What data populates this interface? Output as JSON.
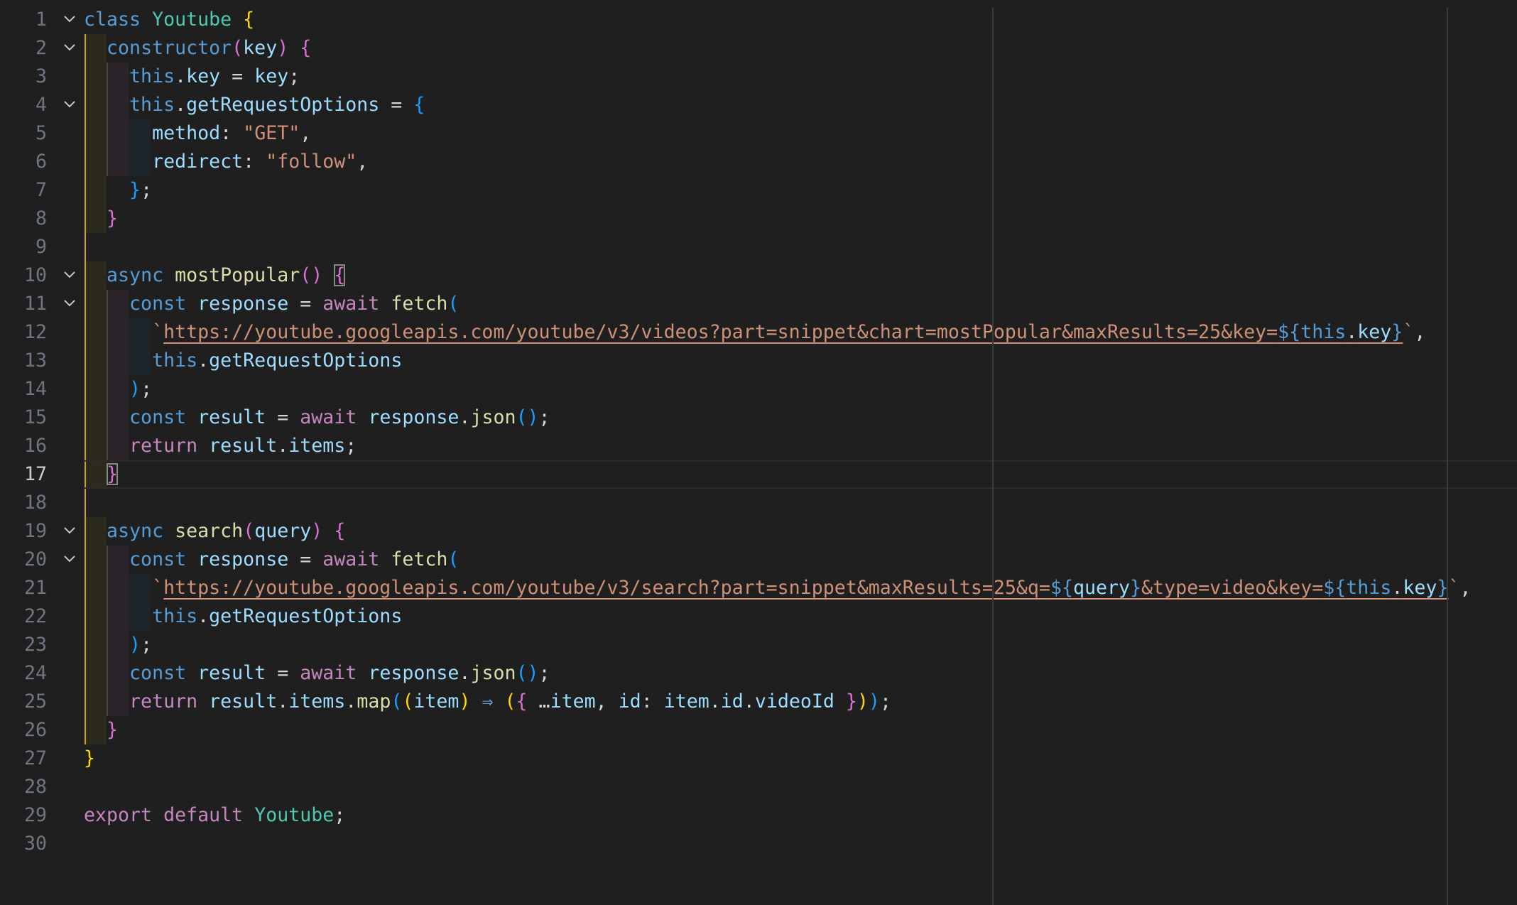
{
  "colors": {
    "background": "#1f1f1f",
    "keyword": "#569cd6",
    "control": "#c586c0",
    "class": "#4ec9b0",
    "function": "#dcdcaa",
    "variable": "#9cdcfe",
    "string": "#ce9178",
    "bracket_level1": "#ffd700",
    "bracket_level2": "#da70d6",
    "bracket_level3": "#179fff"
  },
  "icons": {
    "fold": "chevron-down-icon"
  },
  "editor": {
    "active_line": 17,
    "lines": [
      {
        "number": "1",
        "fold": true,
        "tokens": [
          [
            "class",
            "kw"
          ],
          [
            " ",
            "p"
          ],
          [
            "Youtube",
            "cls"
          ],
          [
            " ",
            "p"
          ],
          [
            "{",
            "b1"
          ]
        ]
      },
      {
        "number": "2",
        "fold": true,
        "tokens": [
          [
            "  ",
            "p"
          ],
          [
            "constructor",
            "kw"
          ],
          [
            "(",
            "b2"
          ],
          [
            "key",
            "var"
          ],
          [
            ")",
            "b2"
          ],
          [
            " ",
            "p"
          ],
          [
            "{",
            "b2"
          ]
        ]
      },
      {
        "number": "3",
        "fold": false,
        "tokens": [
          [
            "    ",
            "p"
          ],
          [
            "this",
            "kw"
          ],
          [
            ".",
            "p"
          ],
          [
            "key",
            "prop"
          ],
          [
            " = ",
            "p"
          ],
          [
            "key",
            "var"
          ],
          [
            ";",
            "p"
          ]
        ]
      },
      {
        "number": "4",
        "fold": true,
        "tokens": [
          [
            "    ",
            "p"
          ],
          [
            "this",
            "kw"
          ],
          [
            ".",
            "p"
          ],
          [
            "getRequestOptions",
            "prop"
          ],
          [
            " = ",
            "p"
          ],
          [
            "{",
            "b3"
          ]
        ]
      },
      {
        "number": "5",
        "fold": false,
        "tokens": [
          [
            "      ",
            "p"
          ],
          [
            "method",
            "prop"
          ],
          [
            ": ",
            "p"
          ],
          [
            "\"GET\"",
            "str"
          ],
          [
            ",",
            "p"
          ]
        ]
      },
      {
        "number": "6",
        "fold": false,
        "tokens": [
          [
            "      ",
            "p"
          ],
          [
            "redirect",
            "prop"
          ],
          [
            ": ",
            "p"
          ],
          [
            "\"follow\"",
            "str"
          ],
          [
            ",",
            "p"
          ]
        ]
      },
      {
        "number": "7",
        "fold": false,
        "tokens": [
          [
            "    ",
            "p"
          ],
          [
            "}",
            "b3"
          ],
          [
            ";",
            "p"
          ]
        ]
      },
      {
        "number": "8",
        "fold": false,
        "tokens": [
          [
            "  ",
            "p"
          ],
          [
            "}",
            "b2"
          ]
        ]
      },
      {
        "number": "9",
        "fold": false,
        "tokens": []
      },
      {
        "number": "10",
        "fold": true,
        "tokens": [
          [
            "  ",
            "p"
          ],
          [
            "async",
            "kw"
          ],
          [
            " ",
            "p"
          ],
          [
            "mostPopular",
            "fn"
          ],
          [
            "()",
            "b2"
          ],
          [
            " ",
            "p"
          ],
          [
            "{",
            "b2 bm"
          ]
        ]
      },
      {
        "number": "11",
        "fold": true,
        "tokens": [
          [
            "    ",
            "p"
          ],
          [
            "const",
            "kw"
          ],
          [
            " ",
            "p"
          ],
          [
            "response",
            "var"
          ],
          [
            " = ",
            "p"
          ],
          [
            "await",
            "ctrl"
          ],
          [
            " ",
            "p"
          ],
          [
            "fetch",
            "fn"
          ],
          [
            "(",
            "b3"
          ]
        ]
      },
      {
        "number": "12",
        "fold": false,
        "tokens": [
          [
            "      ",
            "p"
          ],
          [
            "`",
            "str"
          ],
          [
            "https://youtube.googleapis.com/youtube/v3/videos?part=snippet&chart=mostPopular&maxResults=25&key=",
            "str url"
          ],
          [
            "${",
            "tmpl url"
          ],
          [
            "this",
            "kw url"
          ],
          [
            ".",
            "p url"
          ],
          [
            "key",
            "prop url"
          ],
          [
            "}",
            "tmpl url"
          ],
          [
            "`",
            "str"
          ],
          [
            ",",
            "p"
          ]
        ]
      },
      {
        "number": "13",
        "fold": false,
        "tokens": [
          [
            "      ",
            "p"
          ],
          [
            "this",
            "kw"
          ],
          [
            ".",
            "p"
          ],
          [
            "getRequestOptions",
            "prop"
          ]
        ]
      },
      {
        "number": "14",
        "fold": false,
        "tokens": [
          [
            "    ",
            "p"
          ],
          [
            ")",
            "b3"
          ],
          [
            ";",
            "p"
          ]
        ]
      },
      {
        "number": "15",
        "fold": false,
        "tokens": [
          [
            "    ",
            "p"
          ],
          [
            "const",
            "kw"
          ],
          [
            " ",
            "p"
          ],
          [
            "result",
            "var"
          ],
          [
            " = ",
            "p"
          ],
          [
            "await",
            "ctrl"
          ],
          [
            " ",
            "p"
          ],
          [
            "response",
            "var"
          ],
          [
            ".",
            "p"
          ],
          [
            "json",
            "fn"
          ],
          [
            "()",
            "b3"
          ],
          [
            ";",
            "p"
          ]
        ]
      },
      {
        "number": "16",
        "fold": false,
        "tokens": [
          [
            "    ",
            "p"
          ],
          [
            "return",
            "ctrl"
          ],
          [
            " ",
            "p"
          ],
          [
            "result",
            "var"
          ],
          [
            ".",
            "p"
          ],
          [
            "items",
            "prop"
          ],
          [
            ";",
            "p"
          ]
        ]
      },
      {
        "number": "17",
        "fold": false,
        "tokens": [
          [
            "  ",
            "p"
          ],
          [
            "}",
            "b2 bm"
          ]
        ]
      },
      {
        "number": "18",
        "fold": false,
        "tokens": []
      },
      {
        "number": "19",
        "fold": true,
        "tokens": [
          [
            "  ",
            "p"
          ],
          [
            "async",
            "kw"
          ],
          [
            " ",
            "p"
          ],
          [
            "search",
            "fn"
          ],
          [
            "(",
            "b2"
          ],
          [
            "query",
            "var"
          ],
          [
            ")",
            "b2"
          ],
          [
            " ",
            "p"
          ],
          [
            "{",
            "b2"
          ]
        ]
      },
      {
        "number": "20",
        "fold": true,
        "tokens": [
          [
            "    ",
            "p"
          ],
          [
            "const",
            "kw"
          ],
          [
            " ",
            "p"
          ],
          [
            "response",
            "var"
          ],
          [
            " = ",
            "p"
          ],
          [
            "await",
            "ctrl"
          ],
          [
            " ",
            "p"
          ],
          [
            "fetch",
            "fn"
          ],
          [
            "(",
            "b3"
          ]
        ]
      },
      {
        "number": "21",
        "fold": false,
        "tokens": [
          [
            "      ",
            "p"
          ],
          [
            "`",
            "str"
          ],
          [
            "https://youtube.googleapis.com/youtube/v3/search?part=snippet&maxResults=25&q=",
            "str url"
          ],
          [
            "${",
            "tmpl url"
          ],
          [
            "query",
            "var url"
          ],
          [
            "}",
            "tmpl url"
          ],
          [
            "&type=video&key=",
            "str url"
          ],
          [
            "${",
            "tmpl url"
          ],
          [
            "this",
            "kw url"
          ],
          [
            ".",
            "p url"
          ],
          [
            "key",
            "prop url"
          ],
          [
            "}",
            "tmpl url"
          ],
          [
            "`",
            "str"
          ],
          [
            ",",
            "p"
          ]
        ]
      },
      {
        "number": "22",
        "fold": false,
        "tokens": [
          [
            "      ",
            "p"
          ],
          [
            "this",
            "kw"
          ],
          [
            ".",
            "p"
          ],
          [
            "getRequestOptions",
            "prop"
          ]
        ]
      },
      {
        "number": "23",
        "fold": false,
        "tokens": [
          [
            "    ",
            "p"
          ],
          [
            ")",
            "b3"
          ],
          [
            ";",
            "p"
          ]
        ]
      },
      {
        "number": "24",
        "fold": false,
        "tokens": [
          [
            "    ",
            "p"
          ],
          [
            "const",
            "kw"
          ],
          [
            " ",
            "p"
          ],
          [
            "result",
            "var"
          ],
          [
            " = ",
            "p"
          ],
          [
            "await",
            "ctrl"
          ],
          [
            " ",
            "p"
          ],
          [
            "response",
            "var"
          ],
          [
            ".",
            "p"
          ],
          [
            "json",
            "fn"
          ],
          [
            "()",
            "b3"
          ],
          [
            ";",
            "p"
          ]
        ]
      },
      {
        "number": "25",
        "fold": false,
        "tokens": [
          [
            "    ",
            "p"
          ],
          [
            "return",
            "ctrl"
          ],
          [
            " ",
            "p"
          ],
          [
            "result",
            "var"
          ],
          [
            ".",
            "p"
          ],
          [
            "items",
            "prop"
          ],
          [
            ".",
            "p"
          ],
          [
            "map",
            "fn"
          ],
          [
            "(",
            "b3"
          ],
          [
            "(",
            "b1"
          ],
          [
            "item",
            "var"
          ],
          [
            ")",
            "b1"
          ],
          [
            " ⇒ ",
            "kw"
          ],
          [
            "(",
            "b1"
          ],
          [
            "{",
            "b2"
          ],
          [
            " …",
            "p"
          ],
          [
            "item",
            "var"
          ],
          [
            ", ",
            "p"
          ],
          [
            "id",
            "prop"
          ],
          [
            ": ",
            "p"
          ],
          [
            "item",
            "var"
          ],
          [
            ".",
            "p"
          ],
          [
            "id",
            "prop"
          ],
          [
            ".",
            "p"
          ],
          [
            "videoId",
            "prop"
          ],
          [
            " ",
            "p"
          ],
          [
            "}",
            "b2"
          ],
          [
            ")",
            "b1"
          ],
          [
            ")",
            "b3"
          ],
          [
            ";",
            "p"
          ]
        ]
      },
      {
        "number": "26",
        "fold": false,
        "tokens": [
          [
            "  ",
            "p"
          ],
          [
            "}",
            "b2"
          ]
        ]
      },
      {
        "number": "27",
        "fold": false,
        "tokens": [
          [
            "}",
            "b1"
          ]
        ]
      },
      {
        "number": "28",
        "fold": false,
        "tokens": []
      },
      {
        "number": "29",
        "fold": false,
        "tokens": [
          [
            "export",
            "ctrl"
          ],
          [
            " ",
            "p"
          ],
          [
            "default",
            "ctrl"
          ],
          [
            " ",
            "p"
          ],
          [
            "Youtube",
            "cls"
          ],
          [
            ";",
            "p"
          ]
        ]
      },
      {
        "number": "30",
        "fold": false,
        "tokens": []
      }
    ]
  }
}
